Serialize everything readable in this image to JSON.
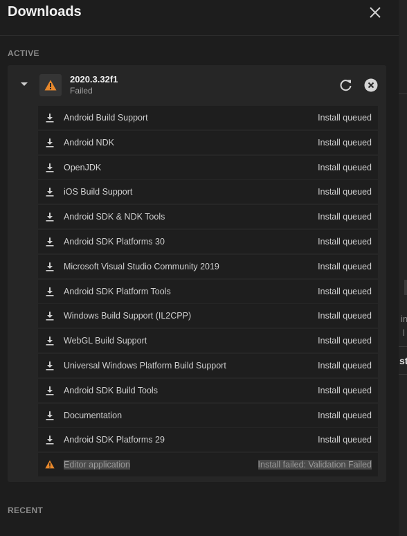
{
  "header": {
    "title": "Downloads",
    "close_icon": "close-icon"
  },
  "sections": {
    "active_label": "ACTIVE",
    "recent_label": "RECENT"
  },
  "download": {
    "version": "2020.3.32f1",
    "status": "Failed",
    "warning_color": "#e8882b",
    "icons": {
      "expand": "caret-down-icon",
      "status": "warning-icon",
      "retry": "retry-icon",
      "cancel": "cancel-icon"
    }
  },
  "modules": [
    {
      "name": "Android Build Support",
      "status": "Install queued",
      "icon": "download-icon"
    },
    {
      "name": "Android NDK",
      "status": "Install queued",
      "icon": "download-icon"
    },
    {
      "name": "OpenJDK",
      "status": "Install queued",
      "icon": "download-icon"
    },
    {
      "name": "iOS Build Support",
      "status": "Install queued",
      "icon": "download-icon"
    },
    {
      "name": "Android SDK & NDK Tools",
      "status": "Install queued",
      "icon": "download-icon"
    },
    {
      "name": "Android SDK Platforms 30",
      "status": "Install queued",
      "icon": "download-icon"
    },
    {
      "name": "Microsoft Visual Studio Community 2019",
      "status": "Install queued",
      "icon": "download-icon"
    },
    {
      "name": "Android SDK Platform Tools",
      "status": "Install queued",
      "icon": "download-icon"
    },
    {
      "name": "Windows Build Support (IL2CPP)",
      "status": "Install queued",
      "icon": "download-icon"
    },
    {
      "name": "WebGL Build Support",
      "status": "Install queued",
      "icon": "download-icon"
    },
    {
      "name": "Universal Windows Platform Build Support",
      "status": "Install queued",
      "icon": "download-icon"
    },
    {
      "name": "Android SDK Build Tools",
      "status": "Install queued",
      "icon": "download-icon"
    },
    {
      "name": "Documentation",
      "status": "Install queued",
      "icon": "download-icon"
    },
    {
      "name": "Android SDK Platforms 29",
      "status": "Install queued",
      "icon": "download-icon"
    },
    {
      "name": "Editor application",
      "status": "Install failed: Validation Failed",
      "icon": "warning-icon"
    }
  ],
  "background": {
    "fragment_1": "in",
    "fragment_2": "l",
    "fragment_3": "st"
  }
}
